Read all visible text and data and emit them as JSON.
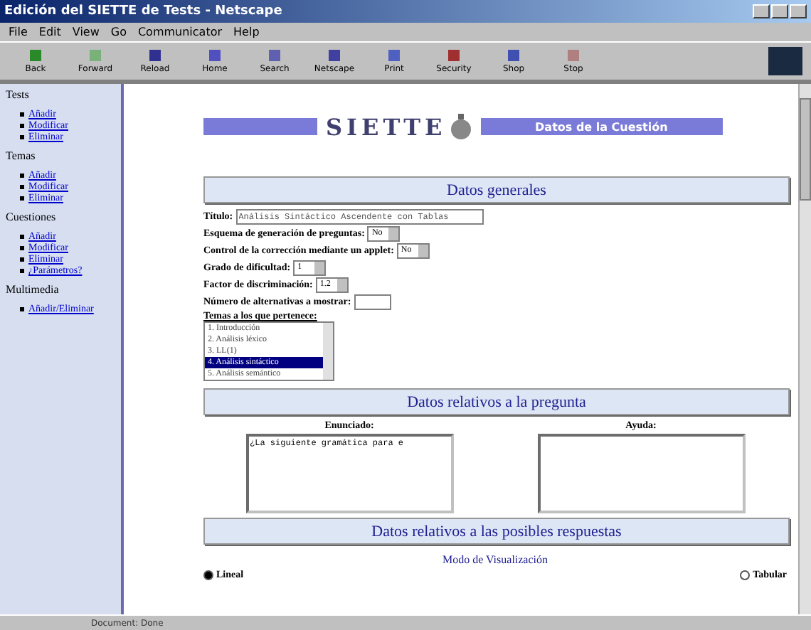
{
  "window": {
    "title": "Edición del SIETTE de Tests - Netscape"
  },
  "menu": [
    "File",
    "Edit",
    "View",
    "Go",
    "Communicator",
    "Help"
  ],
  "toolbar": [
    "Back",
    "Forward",
    "Reload",
    "Home",
    "Search",
    "Netscape",
    "Print",
    "Security",
    "Shop",
    "Stop"
  ],
  "sidebar": [
    {
      "heading": "Tests",
      "items": [
        "Añadir",
        "Modificar",
        "Eliminar"
      ]
    },
    {
      "heading": "Temas",
      "items": [
        "Añadir",
        "Modificar",
        "Eliminar"
      ]
    },
    {
      "heading": "Cuestiones",
      "items": [
        "Añadir",
        "Modificar",
        "Eliminar",
        "¿Parámetros?"
      ]
    },
    {
      "heading": "Multimedia",
      "items": [
        "Añadir/Eliminar"
      ]
    }
  ],
  "header": {
    "logo": "SIETTE",
    "banner": "Datos de la Cuestión"
  },
  "general": {
    "heading": "Datos generales",
    "fields": [
      {
        "kind": "text",
        "label": "Título:",
        "value": "Análisis Sintáctico Ascendente con Tablas"
      },
      {
        "kind": "select",
        "label": "Esquema de generación de preguntas:",
        "value": "No"
      },
      {
        "kind": "select",
        "label": "Control de la corrección mediante un applet:",
        "value": "No"
      },
      {
        "kind": "select",
        "label": "Grado de dificultad:",
        "value": "1"
      },
      {
        "kind": "select",
        "label": "Factor de discriminación:",
        "value": "1.2"
      },
      {
        "kind": "text",
        "label": "Número de alternativas a mostrar:"
      }
    ],
    "topics_label": "Temas a los que pertenece:",
    "topics": [
      {
        "label": "1. Introducción",
        "selected": false
      },
      {
        "label": "2. Análisis léxico",
        "selected": false
      },
      {
        "label": "3. LL(1)",
        "selected": false
      },
      {
        "label": "4. Análisis sintáctico",
        "selected": true
      },
      {
        "label": "5. Análisis semántico",
        "selected": false
      }
    ]
  },
  "question": {
    "heading": "Datos relativos a la pregunta",
    "boxes": [
      {
        "label": "Enunciado:",
        "value": "¿La siguiente gramática para e"
      },
      {
        "label": "Ayuda:"
      }
    ]
  },
  "answers": {
    "heading": "Datos relativos a las posibles respuestas",
    "mode_label": "Modo de Visualización",
    "modes": [
      {
        "label": "Lineal",
        "selected": true
      },
      {
        "label": "Tabular",
        "selected": false
      }
    ]
  },
  "status_bar": {
    "text": "Document: Done"
  }
}
